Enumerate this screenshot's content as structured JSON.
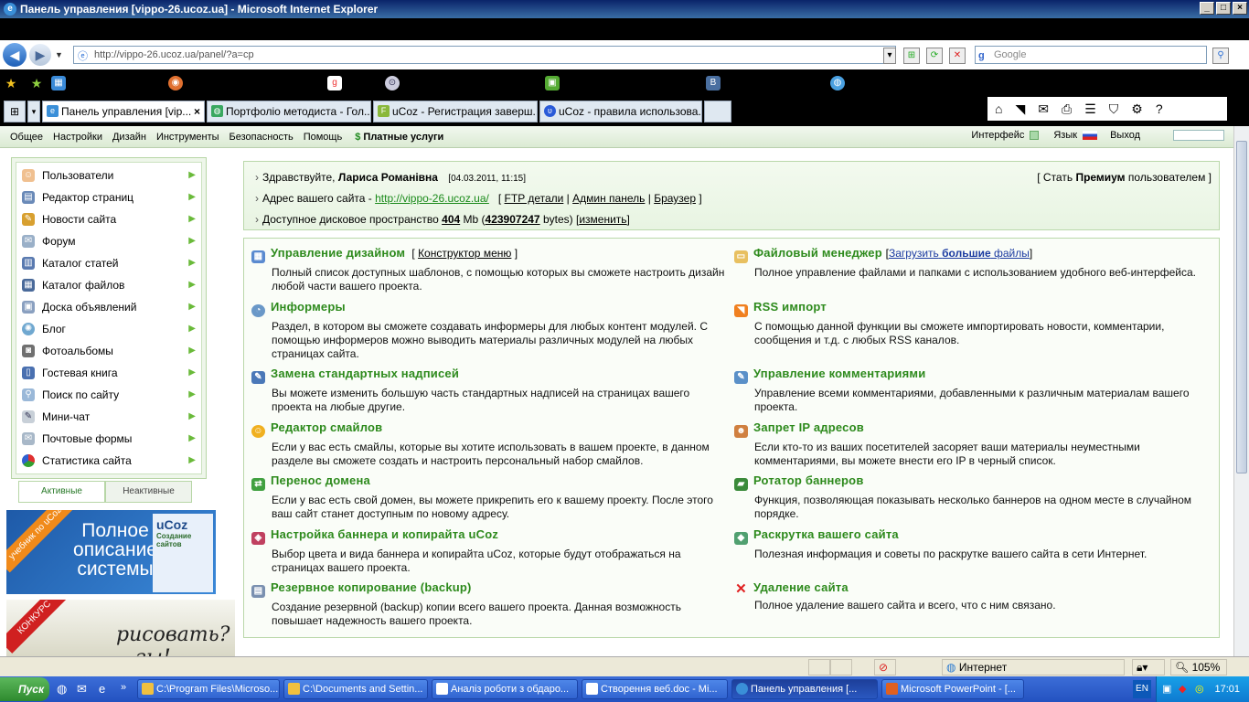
{
  "window": {
    "title": "Панель управления [vippo-26.ucoz.ua] - Microsoft Internet Explorer"
  },
  "address": {
    "url": "http://vippo-26.ucoz.ua/panel/?a=cp",
    "search_placeholder": "Google"
  },
  "tabs": [
    {
      "label": "Панель управления [vip...",
      "active": true
    },
    {
      "label": "Портфоліо методиста - Гол..."
    },
    {
      "label": "uCoz - Регистрация заверш..."
    },
    {
      "label": "uCoz - правила использова..."
    }
  ],
  "topmenu": {
    "items": [
      "Общее",
      "Настройки",
      "Дизайн",
      "Инструменты",
      "Безопасность",
      "Помощь"
    ],
    "paid": "Платные услуги",
    "interface": "Интерфейс",
    "language": "Язык",
    "logout": "Выход"
  },
  "sidebar": {
    "items": [
      "Пользователи",
      "Редактор страниц",
      "Новости сайта",
      "Форум",
      "Каталог статей",
      "Каталог файлов",
      "Доска объявлений",
      "Блог",
      "Фотоальбомы",
      "Гостевая книга",
      "Поиск по сайту",
      "Мини-чат",
      "Почтовые формы",
      "Статистика сайта"
    ],
    "tab_active": "Активные",
    "tab_inactive": "Неактивные"
  },
  "banners": {
    "b1_ribbon": "учебник по uCoz",
    "b1_text": "Полное описание системы",
    "b1_logo": "uCoz",
    "b1_logo_sub": "Создание сайтов",
    "b2_ribbon": "КОНКУРС",
    "b2_text": "рисовать? ...зы!"
  },
  "info": {
    "greeting": "Здравствуйте,",
    "user": "Лариса Романівна",
    "date": "[04.03.2011, 11:15]",
    "premium_pre": "Стать",
    "premium_bold": "Премиум",
    "premium_post": "пользователем",
    "addr_label": "Адрес вашего сайта -",
    "site_url": "http://vippo-26.ucoz.ua/",
    "ftp": "FTP детали",
    "admin": "Админ панель",
    "browser": "Браузер",
    "disk_label": "Доступное дисковое пространство",
    "disk_mb": "404",
    "mb": "Mb",
    "disk_bytes": "423907247",
    "bytes": "bytes)",
    "change": "изменить"
  },
  "entries_left": [
    {
      "title": "Управление дизайном",
      "extra": "Конструктор меню",
      "desc": "Полный список доступных шаблонов, с помощью которых вы сможете настроить дизайн любой части вашего проекта."
    },
    {
      "title": "Информеры",
      "desc": "Раздел, в котором вы сможете создавать информеры для любых контент модулей. С помощью информеров можно выводить материалы различных модулей на любых страницах сайта."
    },
    {
      "title": "Замена стандартных надписей",
      "desc": "Вы можете изменить большую часть стандартных надписей на страницах вашего проекта на любые другие."
    },
    {
      "title": "Редактор смайлов",
      "desc": "Если у вас есть смайлы, которые вы хотите использовать в вашем проекте, в данном разделе вы сможете создать и настроить персональный набор смайлов."
    },
    {
      "title": "Перенос домена",
      "desc": "Если у вас есть свой домен, вы можете прикрепить его к вашему проекту. После этого ваш сайт станет доступным по новому адресу."
    },
    {
      "title": "Настройка баннера и копирайта uCoz",
      "desc": "Выбор цвета и вида баннера и копирайта uCoz, которые будут отображаться на страницах вашего проекта."
    },
    {
      "title": "Резервное копирование (backup)",
      "desc": "Создание резервной (backup) копии всего вашего проекта. Данная возможность повышает надежность вашего проекта."
    }
  ],
  "entries_right": [
    {
      "title": "Файловый менеджер",
      "extra_pre": "Загрузить",
      "extra_bold": "большие",
      "extra_post": "файлы",
      "desc": "Полное управление файлами и папками с использованием удобного веб-интерфейса."
    },
    {
      "title": "RSS импорт",
      "desc": "С помощью данной функции вы сможете импортировать новости, комментарии, сообщения и т.д. с любых RSS каналов."
    },
    {
      "title": "Управление комментариями",
      "desc": "Управление всеми комментариями, добавленными к различным материалам вашего проекта."
    },
    {
      "title": "Запрет IP адресов",
      "desc": "Если кто-то из ваших посетителей засоряет ваши материалы неуместными комментариями, вы можете внести его IP в черный список."
    },
    {
      "title": "Ротатор баннеров",
      "desc": "Функция, позволяющая показывать несколько баннеров на одном месте в случайном порядке."
    },
    {
      "title": "Раскрутка вашего сайта",
      "desc": "Полезная информация и советы по раскрутке вашего сайта в сети Интернет."
    },
    {
      "title": "Удаление сайта",
      "desc": "Полное удаление вашего сайта и всего, что с ним связано."
    }
  ],
  "statusbar": {
    "zone": "Интернет",
    "zoom": "105%"
  },
  "taskbar": {
    "start": "Пуск",
    "tasks": [
      "C:\\Program Files\\Microso...",
      "C:\\Documents and Settin...",
      "Аналіз роботи з обдаро...",
      "Створення веб.doc - Mi...",
      "Панель управления [...",
      "Microsoft PowerPoint - [..."
    ],
    "lang": "EN",
    "clock": "17:01"
  },
  "colors": {
    "accent_green": "#2d8a1c",
    "link_green": "#1a8a1a"
  }
}
